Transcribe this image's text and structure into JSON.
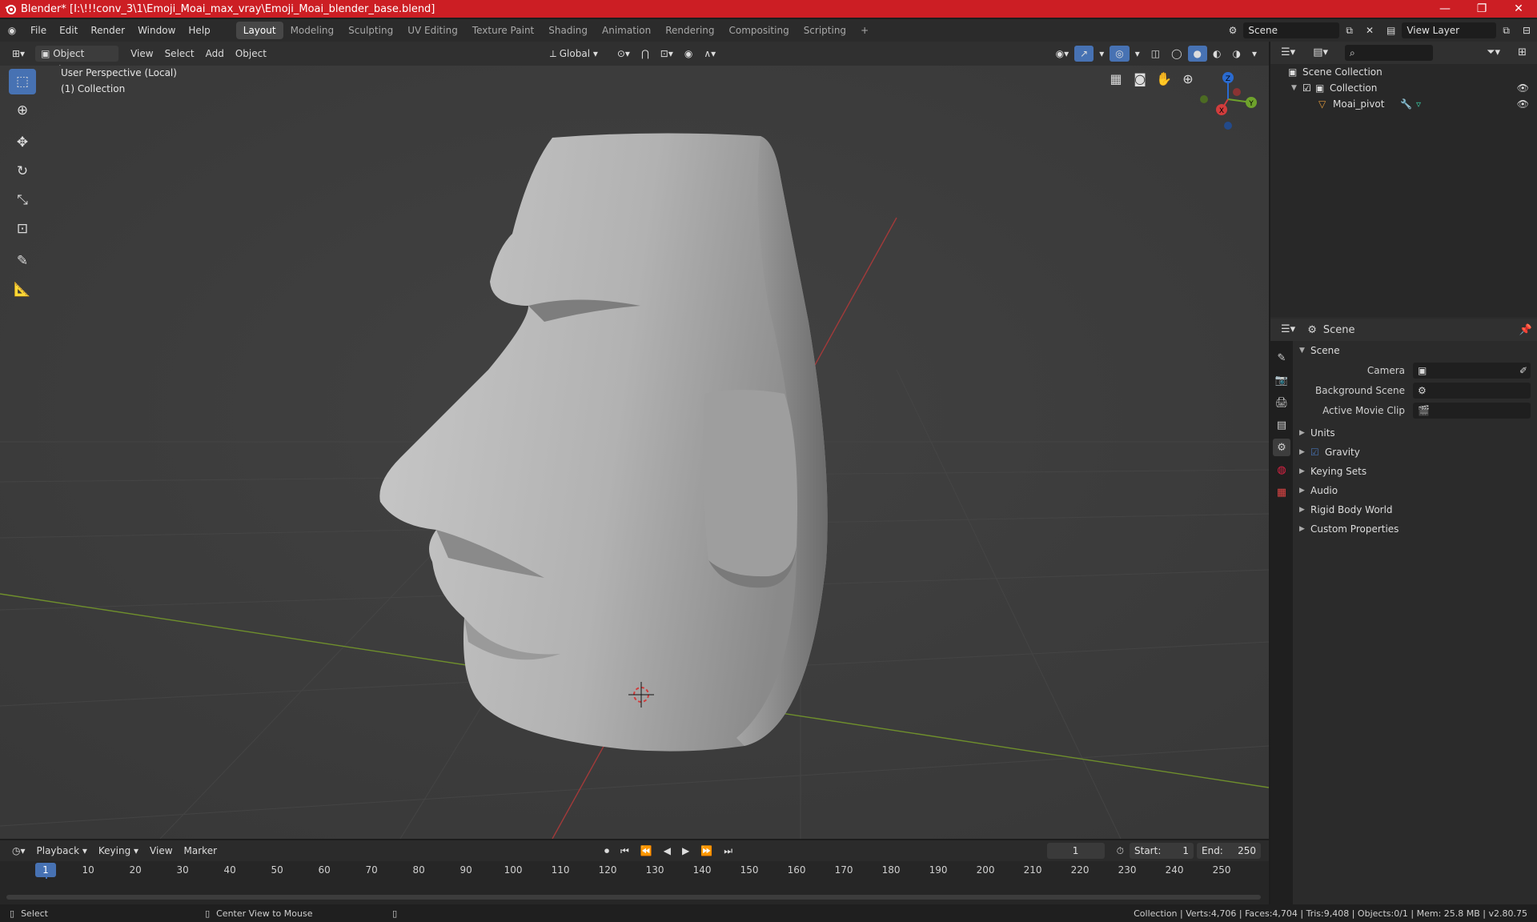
{
  "window": {
    "title": "Blender* [I:\\!!!conv_3\\1\\Emoji_Moai_max_vray\\Emoji_Moai_blender_base.blend]"
  },
  "menu": [
    "File",
    "Edit",
    "Render",
    "Window",
    "Help"
  ],
  "workspaces": [
    "Layout",
    "Modeling",
    "Sculpting",
    "UV Editing",
    "Texture Paint",
    "Shading",
    "Animation",
    "Rendering",
    "Compositing",
    "Scripting"
  ],
  "active_workspace": "Layout",
  "scene_field": "Scene",
  "view_layer_field": "View Layer",
  "viewport_header": {
    "mode": "Object Mode",
    "menus": [
      "View",
      "Select",
      "Add",
      "Object"
    ],
    "orientation": "Global"
  },
  "viewport": {
    "perspective_label": "User Perspective (Local)",
    "collection_label": "(1) Collection"
  },
  "gizmo": {
    "x": "X",
    "y": "Y",
    "z": "Z"
  },
  "outliner": {
    "search_placeholder": "",
    "root": "Scene Collection",
    "collection": "Collection",
    "object": "Moai_pivot"
  },
  "properties": {
    "context": "Scene",
    "panel": "Scene",
    "rows": [
      {
        "label": "Camera",
        "value": ""
      },
      {
        "label": "Background Scene",
        "value": ""
      },
      {
        "label": "Active Movie Clip",
        "value": ""
      }
    ],
    "subpanels": [
      "Units",
      "Gravity",
      "Keying Sets",
      "Audio",
      "Rigid Body World",
      "Custom Properties"
    ],
    "gravity_checked": true
  },
  "timeline": {
    "menus": [
      "Playback",
      "Keying",
      "View",
      "Marker"
    ],
    "current_frame": "1",
    "start_label": "Start:",
    "start": "1",
    "end_label": "End:",
    "end": "250",
    "ticks": [
      "1",
      "10",
      "20",
      "30",
      "40",
      "50",
      "60",
      "70",
      "80",
      "90",
      "100",
      "110",
      "120",
      "130",
      "140",
      "150",
      "160",
      "170",
      "180",
      "190",
      "200",
      "210",
      "220",
      "230",
      "240",
      "250"
    ]
  },
  "statusbar": {
    "left1": "Select",
    "left2": "Center View to Mouse",
    "right": "Collection | Verts:4,706 | Faces:4,704 | Tris:9,408 | Objects:0/1 | Mem: 25.8 MB | v2.80.75"
  }
}
